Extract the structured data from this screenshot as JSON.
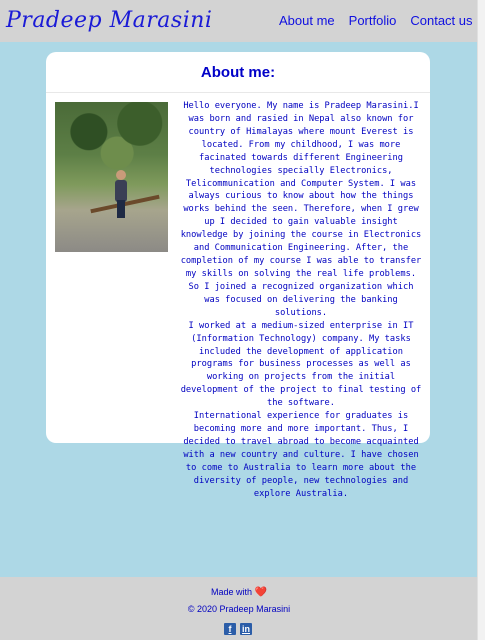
{
  "header": {
    "brand": "Pradeep Marasini",
    "nav": [
      {
        "label": "About me"
      },
      {
        "label": "Portfolio"
      },
      {
        "label": "Contact us"
      }
    ]
  },
  "about": {
    "title": "About me:",
    "bio": [
      "Hello everyone. My name is Pradeep Marasini.I was born and rasied in Nepal also known for country of Himalayas where mount Everest is located. From my childhood, I was more facinated towards different Engineering technologies specially Electronics, Telicommunication and Computer System. I was always curious to know about how the things works behind the seen. Therefore, when I grew up I decided to gain valuable insight knowledge by joining the course in Electronics and Communication Engineering. After, the completion of my course I was able to transfer my skills on solving the real life problems. So I joined a recognized organization which was focused on delivering the banking solutions.",
      "I worked at a medium-sized enterprise in IT (Information Technology) company. My tasks included the development of application programs for business processes as well as working on projects from the initial development of the project to final testing of the software.",
      "International experience for graduates is becoming more and more important. Thus, I decided to travel abroad to become acquainted with a new country and culture. I have chosen to come to Australia to learn more about the diversity of people, new technologies and explore Australia."
    ]
  },
  "footer": {
    "made_with": "Made with",
    "heart": "❤️",
    "copyright": "© 2020 Pradeep Marasini",
    "socials": [
      {
        "icon": "facebook-icon",
        "glyph": "f"
      },
      {
        "icon": "linkedin-icon",
        "glyph": "in"
      }
    ]
  },
  "colors": {
    "page_background": "#add8e6",
    "header_footer_background": "#d3d3d3",
    "text_blue": "#0000c0",
    "social_blue": "#2b5da8"
  }
}
